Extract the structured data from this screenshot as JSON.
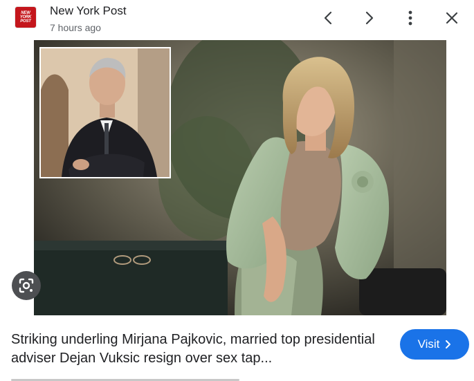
{
  "header": {
    "logo_text": "NEW\nYORK\nPOST",
    "source_name": "New York Post",
    "timestamp": "7 hours ago",
    "buttons": {
      "previous": "chevron-left-icon",
      "next": "chevron-right-icon",
      "more": "more-vert-icon",
      "close": "close-icon"
    }
  },
  "caption": {
    "text": "Striking underling Mirjana Pajkovic, married top presidential adviser Dejan Vuksic resign over sex tap..."
  },
  "visit_button": {
    "label": "Visit",
    "icon": "chevron-right-icon"
  },
  "colors": {
    "accent": "#1a73e8",
    "logo_red": "#c4161c",
    "lens_button": "#4d4f52"
  }
}
